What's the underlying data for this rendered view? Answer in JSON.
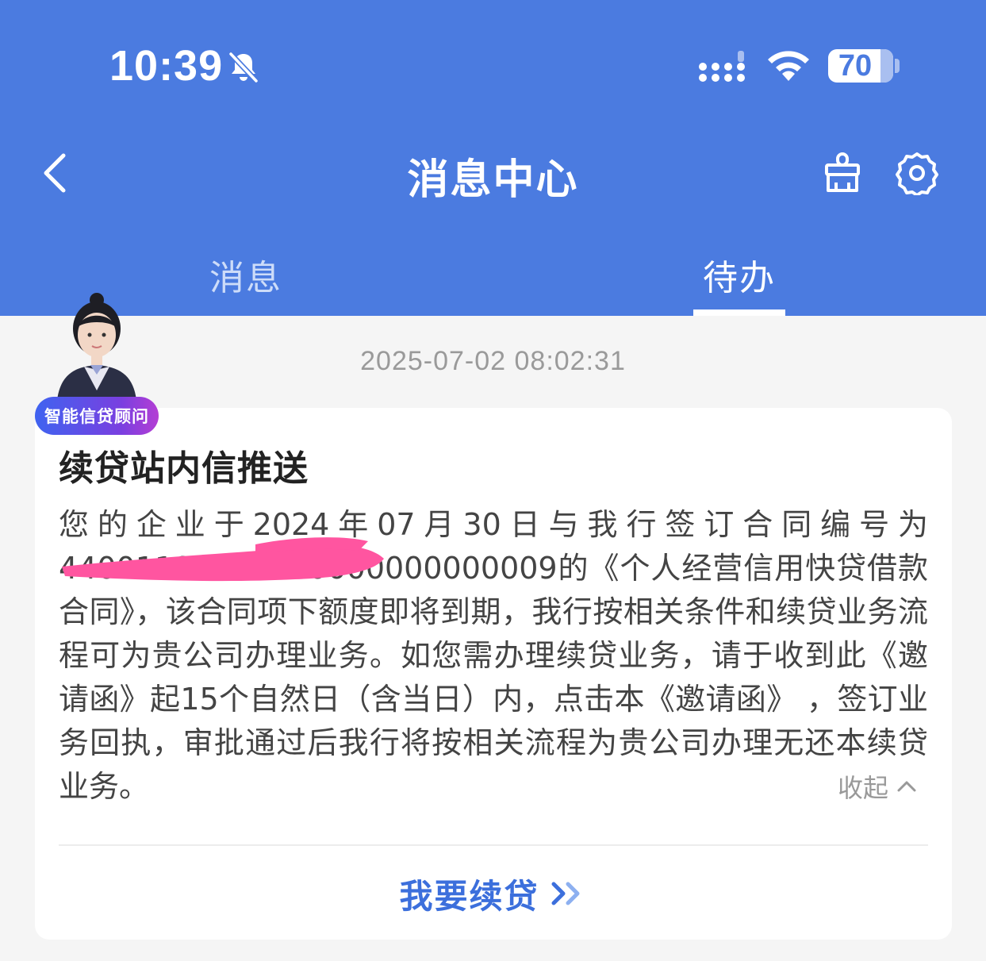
{
  "status_bar": {
    "time": "10:39",
    "battery": "70",
    "icons": [
      "bell-slash-icon",
      "signal-icon",
      "wifi-icon",
      "battery-icon"
    ]
  },
  "header": {
    "title": "消息中心",
    "back_icon": "chevron-left-icon",
    "right_icons": [
      "broom-icon",
      "gear-icon"
    ]
  },
  "tabs": [
    {
      "label": "消息",
      "active": false
    },
    {
      "label": "待办",
      "active": true
    }
  ],
  "message": {
    "timestamp": "2025-07-02 08:02:31",
    "badge": "智能信贷顾问",
    "title": "续贷站内信推送",
    "body": "您的企业于2024年07月30日与我行签订合同编号为44001191500000000000000009的《个人经营信用快贷借款合同》，该合同项下额度即将到期，我行按相关条件和续贷业务流程可为贵公司办理业务。如您需办理续贷业务，请于收到此《邀请函》起15个自然日（含当日）内，点击本《邀请函》 ，签订业务回执，审批通过后我行将按相关流程为贵公司办理无还本续贷业务。",
    "collapse_label": "收起",
    "action_label": "我要续贷"
  },
  "colors": {
    "header_blue": "#4b7be0",
    "action_blue": "#3c6fdc",
    "redaction_pink": "#ff55a0"
  }
}
